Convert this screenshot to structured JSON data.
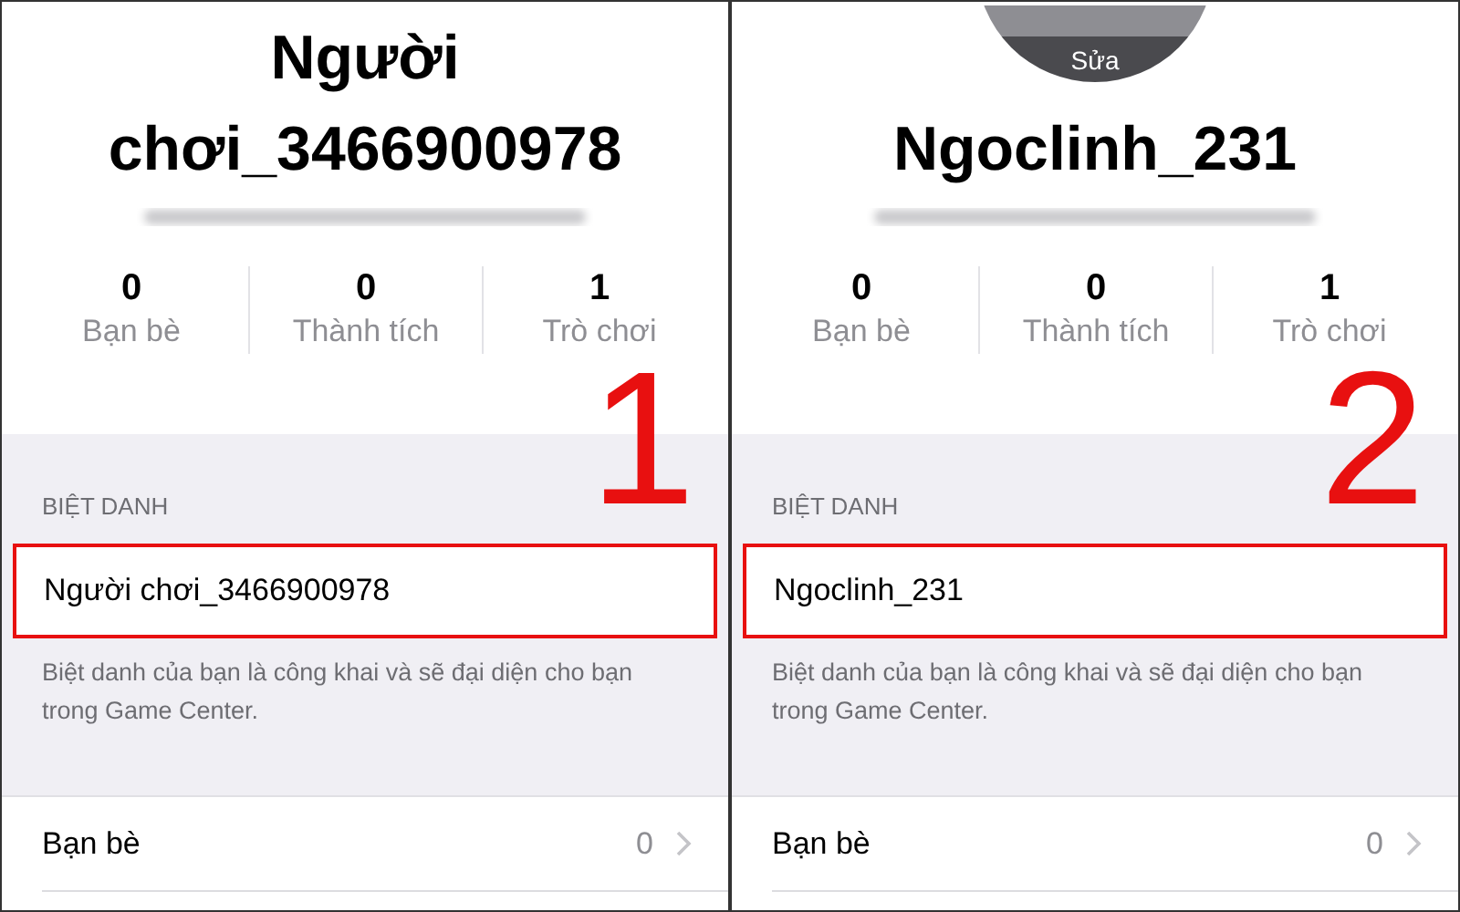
{
  "panels": [
    {
      "name": "Người chơi_3466900978",
      "stats": [
        {
          "value": "0",
          "label": "Bạn bè"
        },
        {
          "value": "0",
          "label": "Thành tích"
        },
        {
          "value": "1",
          "label": "Trò chơi"
        }
      ],
      "step": "1",
      "section_label": "BIỆT DANH",
      "nickname": "Người chơi_3466900978",
      "nickname_highlighted": true,
      "footnote": "Biệt danh của bạn là công khai và sẽ đại diện cho bạn trong Game Center.",
      "row": {
        "label": "Bạn bè",
        "value": "0"
      }
    },
    {
      "avatar_label": "Sửa",
      "name": "Ngoclinh_231",
      "stats": [
        {
          "value": "0",
          "label": "Bạn bè"
        },
        {
          "value": "0",
          "label": "Thành tích"
        },
        {
          "value": "1",
          "label": "Trò chơi"
        }
      ],
      "step": "2",
      "section_label": "BIỆT DANH",
      "nickname": "Ngoclinh_231",
      "nickname_highlighted": true,
      "footnote": "Biệt danh của bạn là công khai và sẽ đại diện cho bạn trong Game Center.",
      "row": {
        "label": "Bạn bè",
        "value": "0"
      }
    }
  ]
}
